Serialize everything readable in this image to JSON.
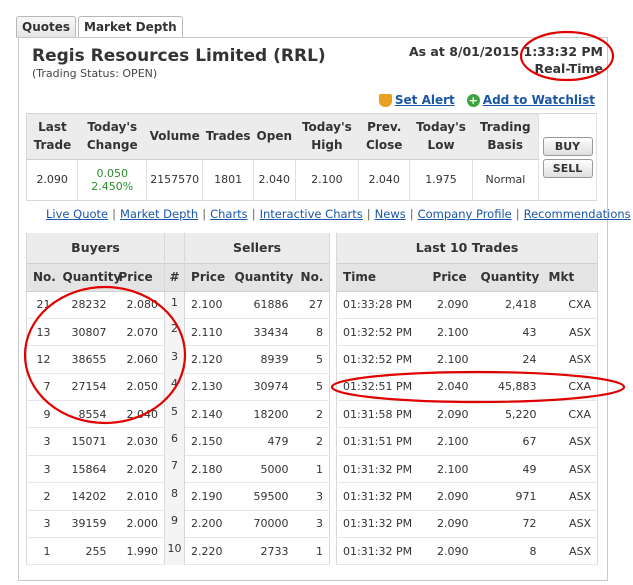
{
  "tabs": [
    {
      "label": "Quotes"
    },
    {
      "label": "Market Depth"
    }
  ],
  "header": {
    "title": "Regis Resources Limited (RRL)",
    "trading_status": "(Trading Status: OPEN)",
    "as_at": "As at 8/01/2015 1:33:32 PM",
    "realtime": "Real-Time"
  },
  "actions": {
    "set_alert": "Set Alert",
    "add_watchlist": "Add to Watchlist"
  },
  "quote": {
    "headers": [
      "Last Trade",
      "Today's Change",
      "Volume",
      "Trades",
      "Open",
      "Today's High",
      "Prev. Close",
      "Today's Low",
      "Trading Basis"
    ],
    "last_trade": "2.090",
    "change": "0.050",
    "change_pct": "2.450%",
    "volume": "2157570",
    "trades": "1801",
    "open": "2.040",
    "high": "2.100",
    "prev_close": "2.040",
    "low": "1.975",
    "basis": "Normal",
    "buy_label": "BUY",
    "sell_label": "SELL"
  },
  "nav": [
    "Live Quote",
    "Market Depth",
    "Charts",
    "Interactive Charts",
    "News",
    "Company Profile",
    "Recommendations"
  ],
  "depth": {
    "buyers_title": "Buyers",
    "sellers_title": "Sellers",
    "trades_title": "Last 10 Trades",
    "buyers_cols": [
      "No.",
      "Quantity",
      "Price"
    ],
    "hash_col": "#",
    "sellers_cols": [
      "Price",
      "Quantity",
      "No."
    ],
    "trades_cols": [
      "Time",
      "Price",
      "Quantity",
      "Mkt"
    ],
    "rows": [
      {
        "b_no": "21",
        "b_qty": "28232",
        "b_price": "2.080",
        "n": "1",
        "s_price": "2.100",
        "s_qty": "61886",
        "s_no": "27",
        "t_time": "01:33:28 PM",
        "t_price": "2.090",
        "t_qty": "2,418",
        "t_mkt": "CXA"
      },
      {
        "b_no": "13",
        "b_qty": "30807",
        "b_price": "2.070",
        "n": "2",
        "s_price": "2.110",
        "s_qty": "33434",
        "s_no": "8",
        "t_time": "01:32:52 PM",
        "t_price": "2.100",
        "t_qty": "43",
        "t_mkt": "ASX"
      },
      {
        "b_no": "12",
        "b_qty": "38655",
        "b_price": "2.060",
        "n": "3",
        "s_price": "2.120",
        "s_qty": "8939",
        "s_no": "5",
        "t_time": "01:32:52 PM",
        "t_price": "2.100",
        "t_qty": "24",
        "t_mkt": "ASX"
      },
      {
        "b_no": "7",
        "b_qty": "27154",
        "b_price": "2.050",
        "n": "4",
        "s_price": "2.130",
        "s_qty": "30974",
        "s_no": "5",
        "t_time": "01:32:51 PM",
        "t_price": "2.040",
        "t_qty": "45,883",
        "t_mkt": "CXA"
      },
      {
        "b_no": "9",
        "b_qty": "8554",
        "b_price": "2.040",
        "n": "5",
        "s_price": "2.140",
        "s_qty": "18200",
        "s_no": "2",
        "t_time": "01:31:58 PM",
        "t_price": "2.090",
        "t_qty": "5,220",
        "t_mkt": "CXA"
      },
      {
        "b_no": "3",
        "b_qty": "15071",
        "b_price": "2.030",
        "n": "6",
        "s_price": "2.150",
        "s_qty": "479",
        "s_no": "2",
        "t_time": "01:31:51 PM",
        "t_price": "2.100",
        "t_qty": "67",
        "t_mkt": "ASX"
      },
      {
        "b_no": "3",
        "b_qty": "15864",
        "b_price": "2.020",
        "n": "7",
        "s_price": "2.180",
        "s_qty": "5000",
        "s_no": "1",
        "t_time": "01:31:32 PM",
        "t_price": "2.100",
        "t_qty": "49",
        "t_mkt": "ASX"
      },
      {
        "b_no": "2",
        "b_qty": "14202",
        "b_price": "2.010",
        "n": "8",
        "s_price": "2.190",
        "s_qty": "59500",
        "s_no": "3",
        "t_time": "01:31:32 PM",
        "t_price": "2.090",
        "t_qty": "971",
        "t_mkt": "ASX"
      },
      {
        "b_no": "3",
        "b_qty": "39159",
        "b_price": "2.000",
        "n": "9",
        "s_price": "2.200",
        "s_qty": "70000",
        "s_no": "3",
        "t_time": "01:31:32 PM",
        "t_price": "2.090",
        "t_qty": "72",
        "t_mkt": "ASX"
      },
      {
        "b_no": "1",
        "b_qty": "255",
        "b_price": "1.990",
        "n": "10",
        "s_price": "2.220",
        "s_qty": "2733",
        "s_no": "1",
        "t_time": "01:31:32 PM",
        "t_price": "2.090",
        "t_qty": "8",
        "t_mkt": "ASX"
      }
    ]
  },
  "annotation_color": "#e00000"
}
